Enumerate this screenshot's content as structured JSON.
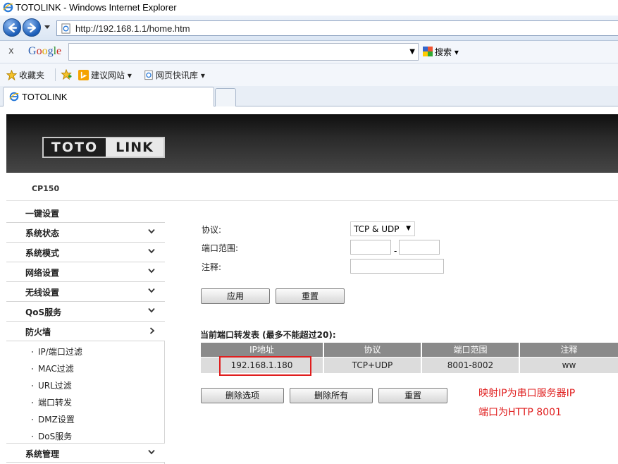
{
  "window": {
    "title": "TOTOLINK - Windows Internet Explorer"
  },
  "address_bar": {
    "url": "http://192.168.1.1/home.htm"
  },
  "google_bar": {
    "close": "x",
    "logo": {
      "letters": [
        "G",
        "o",
        "o",
        "g",
        "l",
        "e"
      ]
    },
    "search_placeholder": "",
    "search_label": "搜索"
  },
  "favorites_bar": {
    "favorites_label": "收藏夹",
    "suggested_sites": "建议网站",
    "web_slice": "网页快讯库"
  },
  "tab": {
    "title": "TOTOLINK"
  },
  "router": {
    "logo_left": "TOTO",
    "logo_right": "LINK",
    "model": "CP150",
    "menu": [
      {
        "label": "一键设置"
      },
      {
        "label": "系统状态"
      },
      {
        "label": "系统模式"
      },
      {
        "label": "网络设置"
      },
      {
        "label": "无线设置"
      },
      {
        "label": "QoS服务"
      },
      {
        "label": "防火墙"
      }
    ],
    "firewall_submenu": [
      {
        "label": "IP/端口过滤"
      },
      {
        "label": "MAC过滤"
      },
      {
        "label": "URL过滤"
      },
      {
        "label": "端口转发"
      },
      {
        "label": "DMZ设置"
      },
      {
        "label": "DoS服务"
      }
    ],
    "menu_last": {
      "label": "系统管理"
    },
    "form": {
      "protocol_label": "协议:",
      "protocol_value": "TCP & UDP",
      "port_range_label": "端口范围:",
      "port_from": "",
      "port_to": "",
      "port_separator": "-",
      "comment_label": "注释:",
      "comment_value": "",
      "apply_button": "应用",
      "reset_button": "重置"
    },
    "table": {
      "title": "当前端口转发表 (最多不能超过20):",
      "columns": [
        "IP地址",
        "协议",
        "端口范围",
        "注释"
      ],
      "rows": [
        [
          "192.168.1.180",
          "TCP+UDP",
          "8001-8002",
          "ww"
        ]
      ]
    },
    "table_buttons": {
      "delete_selected": "删除选项",
      "delete_all": "删除所有",
      "reset": "重置"
    }
  },
  "annotation": {
    "line1": "映射IP为串口服务器IP",
    "line2": "端口为HTTP  8001",
    "color": "#e02020"
  }
}
